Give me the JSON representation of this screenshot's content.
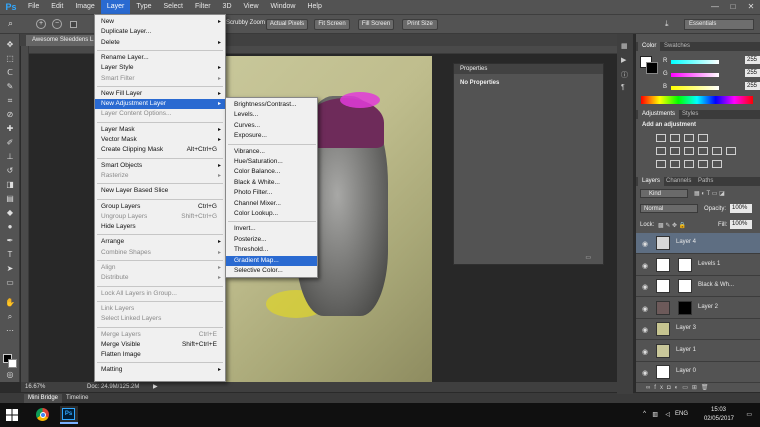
{
  "menubar": {
    "logo": "Ps",
    "items": [
      "File",
      "Edit",
      "Image",
      "Layer",
      "Type",
      "Select",
      "Filter",
      "3D",
      "View",
      "Window",
      "Help"
    ],
    "active": "Layer",
    "window_controls": [
      "—",
      "□",
      "✕"
    ]
  },
  "options": {
    "scrubby_zoom": "Scrubby Zoom",
    "actual_pixels": "Actual Pixels",
    "fit_screen": "Fit Screen",
    "fill_screen": "Fill Screen",
    "print_size": "Print Size",
    "workspace": "Essentials"
  },
  "document": {
    "tab_label": "Awesome Sleeddens L...",
    "zoom": "16.67%",
    "doc_info": "Doc: 24.9M/125.2M"
  },
  "layer_menu": {
    "items": [
      {
        "label": "New",
        "submenu": true,
        "disabled": false
      },
      {
        "label": "Duplicate Layer...",
        "disabled": false
      },
      {
        "label": "Delete",
        "submenu": true,
        "disabled": false
      },
      {
        "sep": true
      },
      {
        "label": "Rename Layer...",
        "disabled": false
      },
      {
        "label": "Layer Style",
        "submenu": true,
        "disabled": false
      },
      {
        "label": "Smart Filter",
        "submenu": true,
        "disabled": true
      },
      {
        "sep": true
      },
      {
        "label": "New Fill Layer",
        "submenu": true,
        "disabled": false
      },
      {
        "label": "New Adjustment Layer",
        "submenu": true,
        "disabled": false,
        "highlight": true
      },
      {
        "label": "Layer Content Options...",
        "disabled": true
      },
      {
        "sep": true
      },
      {
        "label": "Layer Mask",
        "submenu": true,
        "disabled": false
      },
      {
        "label": "Vector Mask",
        "submenu": true,
        "disabled": false
      },
      {
        "label": "Create Clipping Mask",
        "shortcut": "Alt+Ctrl+G",
        "disabled": false
      },
      {
        "sep": true
      },
      {
        "label": "Smart Objects",
        "submenu": true,
        "disabled": false
      },
      {
        "label": "Rasterize",
        "submenu": true,
        "disabled": true
      },
      {
        "sep": true
      },
      {
        "label": "New Layer Based Slice",
        "disabled": false
      },
      {
        "sep": true
      },
      {
        "label": "Group Layers",
        "shortcut": "Ctrl+G",
        "disabled": false
      },
      {
        "label": "Ungroup Layers",
        "shortcut": "Shift+Ctrl+G",
        "disabled": true
      },
      {
        "label": "Hide Layers",
        "disabled": false
      },
      {
        "sep": true
      },
      {
        "label": "Arrange",
        "submenu": true,
        "disabled": false
      },
      {
        "label": "Combine Shapes",
        "submenu": true,
        "disabled": true
      },
      {
        "sep": true
      },
      {
        "label": "Align",
        "submenu": true,
        "disabled": true
      },
      {
        "label": "Distribute",
        "submenu": true,
        "disabled": true
      },
      {
        "sep": true
      },
      {
        "label": "Lock All Layers in Group...",
        "disabled": true
      },
      {
        "sep": true
      },
      {
        "label": "Link Layers",
        "disabled": true
      },
      {
        "label": "Select Linked Layers",
        "disabled": true
      },
      {
        "sep": true
      },
      {
        "label": "Merge Layers",
        "shortcut": "Ctrl+E",
        "disabled": true
      },
      {
        "label": "Merge Visible",
        "shortcut": "Shift+Ctrl+E",
        "disabled": false
      },
      {
        "label": "Flatten Image",
        "disabled": false
      },
      {
        "sep": true
      },
      {
        "label": "Matting",
        "submenu": true,
        "disabled": false
      }
    ]
  },
  "adjustment_submenu": {
    "items": [
      {
        "label": "Brightness/Contrast..."
      },
      {
        "label": "Levels..."
      },
      {
        "label": "Curves..."
      },
      {
        "label": "Exposure..."
      },
      {
        "sep": true
      },
      {
        "label": "Vibrance..."
      },
      {
        "label": "Hue/Saturation..."
      },
      {
        "label": "Color Balance..."
      },
      {
        "label": "Black & White..."
      },
      {
        "label": "Photo Filter..."
      },
      {
        "label": "Channel Mixer..."
      },
      {
        "label": "Color Lookup..."
      },
      {
        "sep": true
      },
      {
        "label": "Invert..."
      },
      {
        "label": "Posterize..."
      },
      {
        "label": "Threshold..."
      },
      {
        "label": "Gradient Map...",
        "highlight": true
      },
      {
        "label": "Selective Color..."
      }
    ]
  },
  "properties": {
    "title": "Properties",
    "body": "No Properties"
  },
  "color_panel": {
    "tabs": [
      "Color",
      "Swatches"
    ],
    "r_label": "R",
    "r_value": "255",
    "g_label": "G",
    "g_value": "255",
    "b_label": "B",
    "b_value": "255"
  },
  "adjustments_panel": {
    "tabs": [
      "Adjustments",
      "Styles"
    ],
    "heading": "Add an adjustment"
  },
  "layers_panel": {
    "tabs": [
      "Layers",
      "Channels",
      "Paths"
    ],
    "kind": "Kind",
    "blend_mode": "Normal",
    "opacity_label": "Opacity:",
    "opacity_value": "100%",
    "lock_label": "Lock:",
    "fill_label": "Fill:",
    "fill_value": "100%",
    "layers": [
      {
        "name": "Layer 4",
        "selected": true
      },
      {
        "name": "Levels 1"
      },
      {
        "name": "Black & Wh..."
      },
      {
        "name": "Layer 2"
      },
      {
        "name": "Layer 3"
      },
      {
        "name": "Layer 1"
      },
      {
        "name": "Layer 0"
      }
    ]
  },
  "bottom_tabs": [
    "Mini Bridge",
    "Timeline"
  ],
  "taskbar": {
    "lang": "ENG",
    "time": "15:03",
    "date": "02/05/2017"
  }
}
